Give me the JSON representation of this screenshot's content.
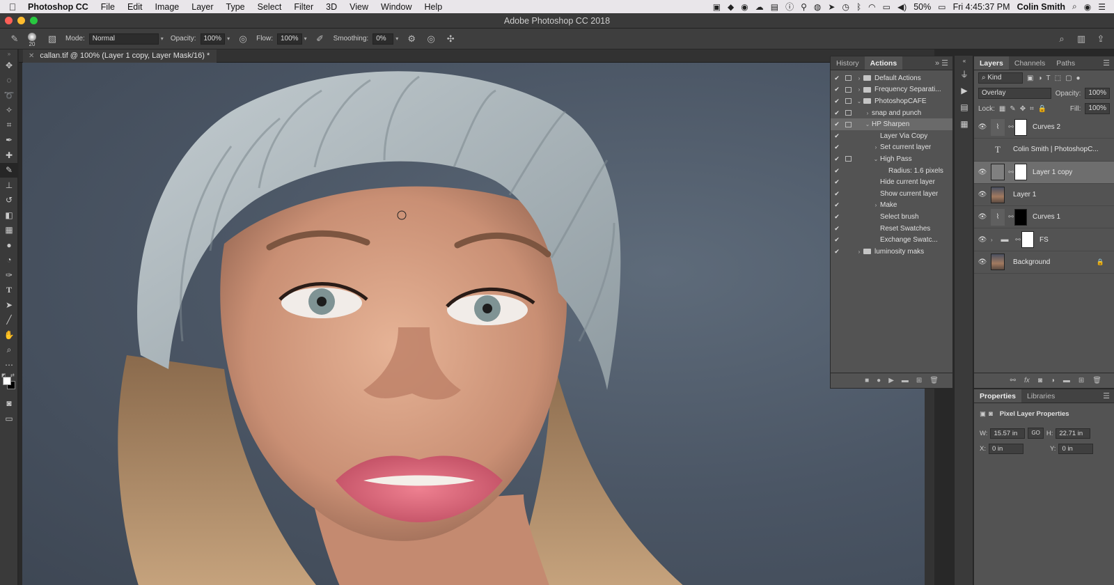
{
  "menubar": {
    "app_name": "Photoshop CC",
    "items": [
      "File",
      "Edit",
      "Image",
      "Layer",
      "Type",
      "Select",
      "Filter",
      "3D",
      "View",
      "Window",
      "Help"
    ],
    "battery": "50%",
    "clock": "Fri 4:45:37 PM",
    "user": "Colin Smith"
  },
  "window": {
    "title": "Adobe Photoshop CC 2018"
  },
  "options": {
    "brush_size": "20",
    "mode_label": "Mode:",
    "mode_value": "Normal",
    "opacity_label": "Opacity:",
    "opacity_value": "100%",
    "flow_label": "Flow:",
    "flow_value": "100%",
    "smoothing_label": "Smoothing:",
    "smoothing_value": "0%"
  },
  "document": {
    "tab_title": "callan.tif @ 100% (Layer 1 copy, Layer Mask/16) *"
  },
  "actions_panel": {
    "tabs": [
      "History",
      "Actions"
    ],
    "rows": [
      {
        "label": "Default Actions",
        "indent": 0,
        "twist": "›",
        "folder": true,
        "dialog": true
      },
      {
        "label": "Frequency Separati...",
        "indent": 0,
        "twist": "›",
        "folder": true,
        "dialog": true
      },
      {
        "label": "PhotoshopCAFE",
        "indent": 0,
        "twist": "⌄",
        "folder": true,
        "dialog": true
      },
      {
        "label": "snap and punch",
        "indent": 1,
        "twist": "›",
        "folder": false,
        "dialog": true
      },
      {
        "label": "HP Sharpen",
        "indent": 1,
        "twist": "⌄",
        "folder": false,
        "dialog": true,
        "selected": true
      },
      {
        "label": "Layer Via Copy",
        "indent": 2,
        "twist": "",
        "folder": false,
        "dialog": false
      },
      {
        "label": "Set current layer",
        "indent": 2,
        "twist": "›",
        "folder": false,
        "dialog": false
      },
      {
        "label": "High Pass",
        "indent": 2,
        "twist": "⌄",
        "folder": false,
        "dialog": true
      },
      {
        "label": "Radius: 1.6 pixels",
        "indent": 3,
        "twist": "",
        "folder": false,
        "dialog": false,
        "nocheck": true
      },
      {
        "label": "Hide current layer",
        "indent": 2,
        "twist": "",
        "folder": false,
        "dialog": false
      },
      {
        "label": "Show current layer",
        "indent": 2,
        "twist": "",
        "folder": false,
        "dialog": false
      },
      {
        "label": "Make",
        "indent": 2,
        "twist": "›",
        "folder": false,
        "dialog": false
      },
      {
        "label": "Select brush",
        "indent": 2,
        "twist": "",
        "folder": false,
        "dialog": false
      },
      {
        "label": "Reset Swatches",
        "indent": 2,
        "twist": "",
        "folder": false,
        "dialog": false
      },
      {
        "label": "Exchange Swatc...",
        "indent": 2,
        "twist": "",
        "folder": false,
        "dialog": false
      },
      {
        "label": "luminosity maks",
        "indent": 0,
        "twist": "›",
        "folder": true,
        "dialog": false
      }
    ]
  },
  "layers_panel": {
    "tabs": [
      "Layers",
      "Channels",
      "Paths"
    ],
    "filter_kind": "Kind",
    "blend_mode": "Overlay",
    "opacity_label": "Opacity:",
    "opacity_value": "100%",
    "lock_label": "Lock:",
    "fill_label": "Fill:",
    "fill_value": "100%",
    "layers": [
      {
        "name": "Curves 2",
        "visible": true,
        "type": "adjustment",
        "mask": "white"
      },
      {
        "name": "Colin Smith  | PhotoshopC...",
        "visible": false,
        "type": "text",
        "mask": ""
      },
      {
        "name": "Layer 1 copy",
        "visible": true,
        "type": "pixel",
        "mask": "white",
        "selected": true
      },
      {
        "name": "Layer 1",
        "visible": true,
        "type": "photo",
        "mask": ""
      },
      {
        "name": "Curves 1",
        "visible": true,
        "type": "adjustment",
        "mask": "black"
      },
      {
        "name": "FS",
        "visible": true,
        "type": "group",
        "mask": "white"
      },
      {
        "name": "Background",
        "visible": true,
        "type": "photo",
        "mask": "",
        "locked": true
      }
    ]
  },
  "properties_panel": {
    "tabs": [
      "Properties",
      "Libraries"
    ],
    "heading": "Pixel Layer Properties",
    "w_label": "W:",
    "w_value": "15.57 in",
    "h_label": "H:",
    "h_value": "22.71 in",
    "x_label": "X:",
    "x_value": "0 in",
    "y_label": "Y:",
    "y_value": "0 in",
    "link_label": "GO"
  }
}
